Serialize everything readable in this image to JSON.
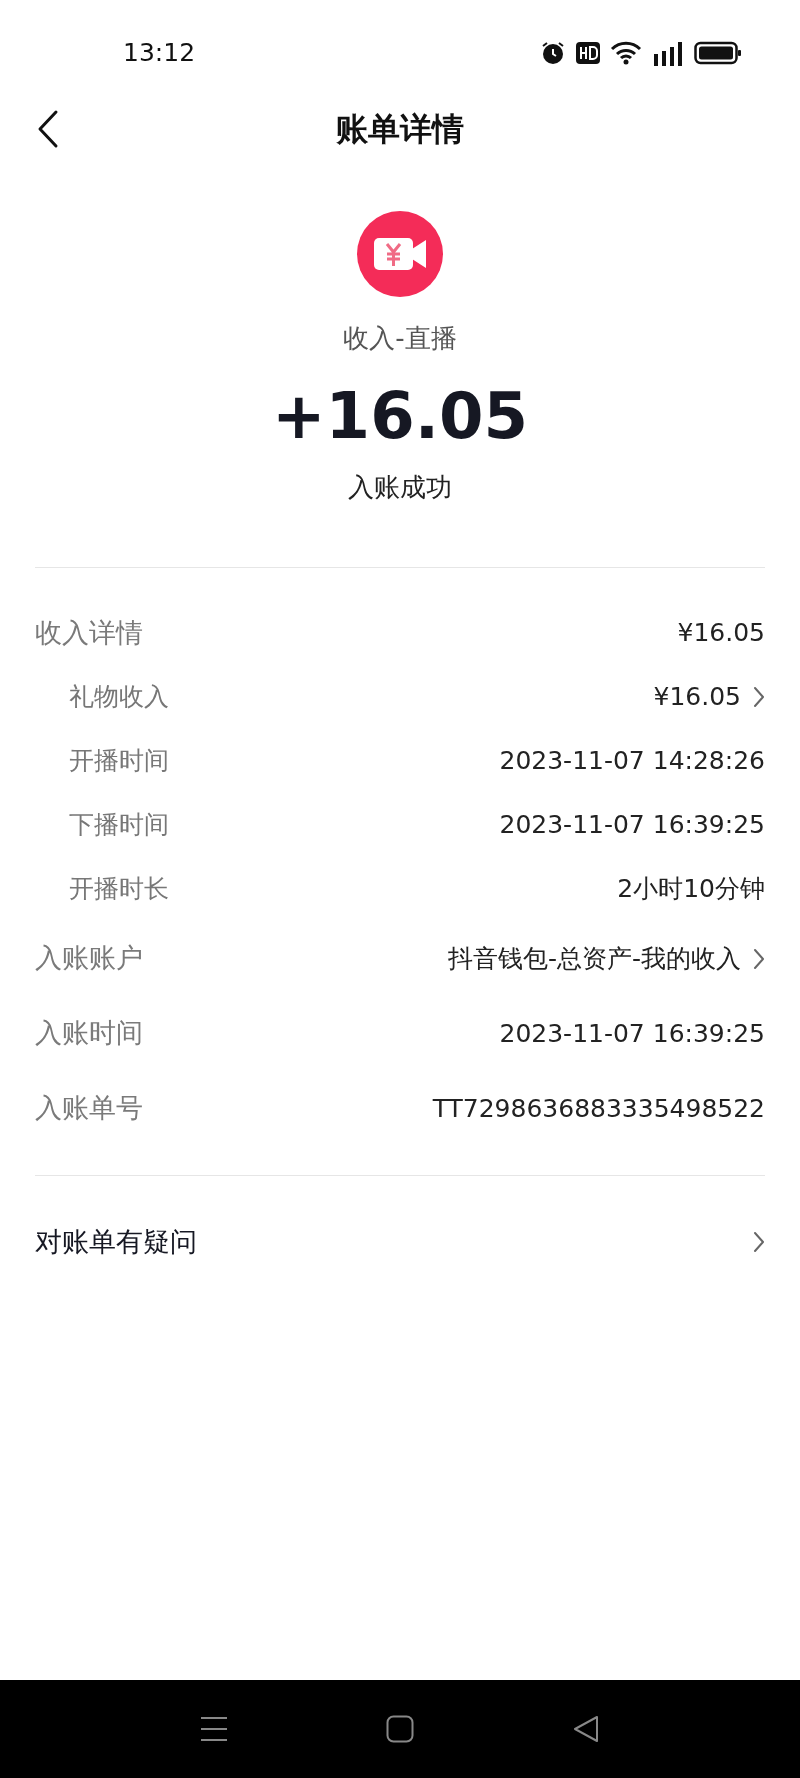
{
  "status_bar": {
    "time": "13:12"
  },
  "header": {
    "title": "账单详情"
  },
  "summary": {
    "category": "收入-直播",
    "amount": "+16.05",
    "status": "入账成功"
  },
  "details": [
    {
      "kind": "main",
      "label": "收入详情",
      "value": "¥16.05",
      "chevron": false
    },
    {
      "kind": "sub",
      "label": "礼物收入",
      "value": "¥16.05",
      "chevron": true
    },
    {
      "kind": "sub",
      "label": "开播时间",
      "value": "2023-11-07 14:28:26",
      "chevron": false
    },
    {
      "kind": "sub",
      "label": "下播时间",
      "value": "2023-11-07 16:39:25",
      "chevron": false
    },
    {
      "kind": "sub",
      "label": "开播时长",
      "value": "2小时10分钟",
      "chevron": false
    },
    {
      "kind": "main",
      "label": "入账账户",
      "value": "抖音钱包-总资产-我的收入",
      "chevron": true
    },
    {
      "kind": "main",
      "label": "入账时间",
      "value": "2023-11-07 16:39:25",
      "chevron": false
    },
    {
      "kind": "main",
      "label": "入账单号",
      "value": "TT7298636883335498522",
      "chevron": false
    }
  ],
  "question": {
    "label": "对账单有疑问"
  }
}
